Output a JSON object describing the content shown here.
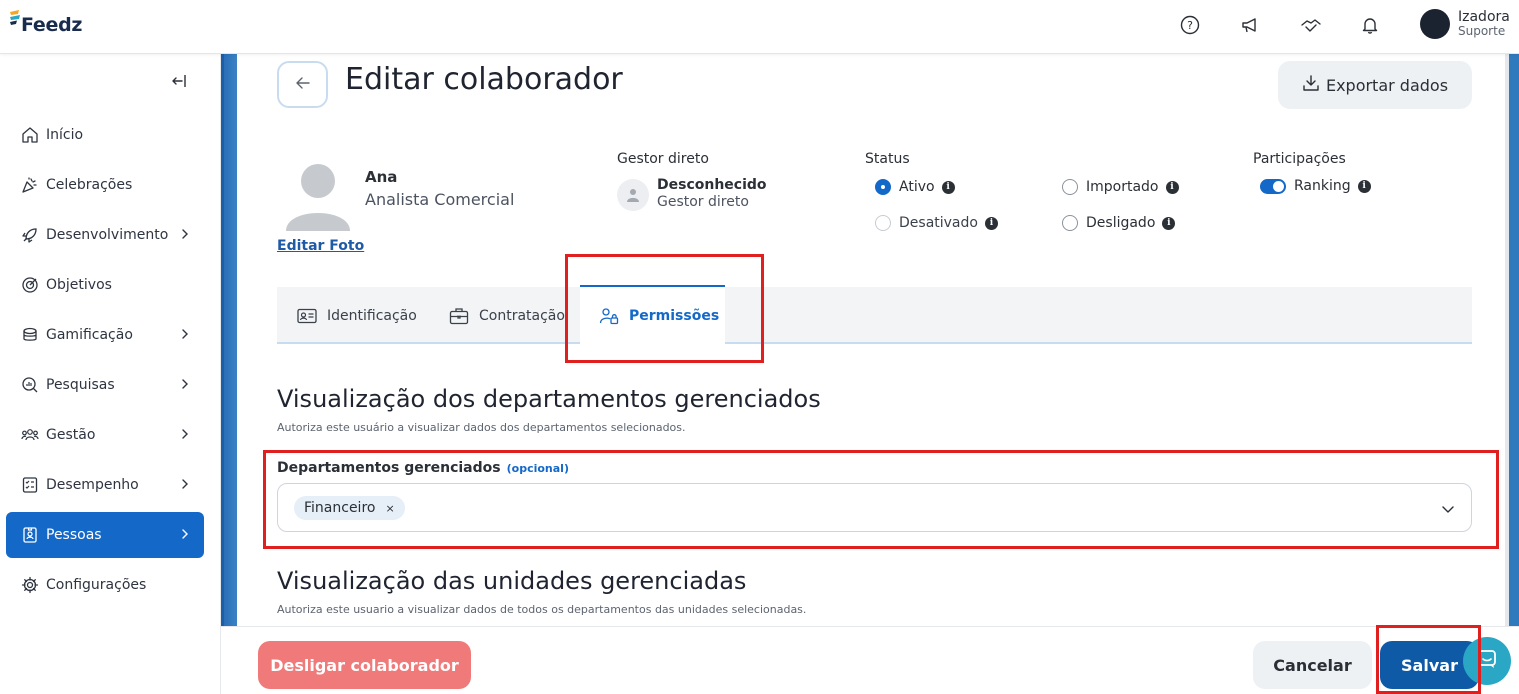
{
  "app": {
    "logo_text": "Feedz"
  },
  "topbar": {
    "icons": [
      "help-icon",
      "megaphone-icon",
      "handshake-icon",
      "bell-icon"
    ],
    "user": {
      "name": "Izadora",
      "role": "Suporte"
    }
  },
  "sidebar": {
    "items": [
      {
        "label": "Início",
        "icon": "home-icon",
        "has_chevron": false
      },
      {
        "label": "Celebrações",
        "icon": "party-icon",
        "has_chevron": false
      },
      {
        "label": "Desenvolvimento",
        "icon": "rocket-icon",
        "has_chevron": true
      },
      {
        "label": "Objetivos",
        "icon": "target-icon",
        "has_chevron": false
      },
      {
        "label": "Gamificação",
        "icon": "coins-icon",
        "has_chevron": true
      },
      {
        "label": "Pesquisas",
        "icon": "search-chart-icon",
        "has_chevron": true
      },
      {
        "label": "Gestão",
        "icon": "team-icon",
        "has_chevron": true
      },
      {
        "label": "Desempenho",
        "icon": "checklist-icon",
        "has_chevron": true
      },
      {
        "label": "Pessoas",
        "icon": "badge-icon",
        "has_chevron": true,
        "active": true
      },
      {
        "label": "Configurações",
        "icon": "gear-icon",
        "has_chevron": false
      }
    ]
  },
  "header": {
    "title": "Editar colaborador",
    "export_label": "Exportar dados"
  },
  "employee": {
    "name": "Ana",
    "role": "Analista Comercial",
    "edit_photo": "Editar Foto"
  },
  "manager": {
    "label": "Gestor direto",
    "name": "Desconhecido",
    "sub": "Gestor direto"
  },
  "status": {
    "label": "Status",
    "options": [
      {
        "label": "Ativo",
        "selected": true
      },
      {
        "label": "Importado",
        "selected": false
      },
      {
        "label": "Desativado",
        "selected": false
      },
      {
        "label": "Desligado",
        "selected": false
      }
    ]
  },
  "participations": {
    "label": "Participações",
    "ranking_label": "Ranking",
    "ranking_on": true
  },
  "tabs": [
    {
      "label": "Identificação",
      "icon": "id-card-icon"
    },
    {
      "label": "Contratação",
      "icon": "briefcase-icon"
    },
    {
      "label": "Permissões",
      "icon": "user-lock-icon",
      "active": true
    }
  ],
  "section1": {
    "title": "Visualização dos departamentos gerenciados",
    "subtitle": "Autoriza este usuário a visualizar dados dos departamentos selecionados.",
    "field_label": "Departamentos gerenciados",
    "optional": "(opcional)",
    "chips": [
      "Financeiro"
    ],
    "chip_remove": "×"
  },
  "section2": {
    "title": "Visualização das unidades gerenciadas",
    "subtitle": "Autoriza este usuario a visualizar dados de todos os departamentos das unidades selecionadas."
  },
  "footer": {
    "disconnect_label": "Desligar colaborador",
    "cancel_label": "Cancelar",
    "save_label": "Salvar"
  },
  "colors": {
    "primary": "#1468c8",
    "save": "#0f5aa6",
    "danger": "#f07a7a",
    "highlight": "#e01f1f",
    "chat": "#2aa7c4"
  }
}
